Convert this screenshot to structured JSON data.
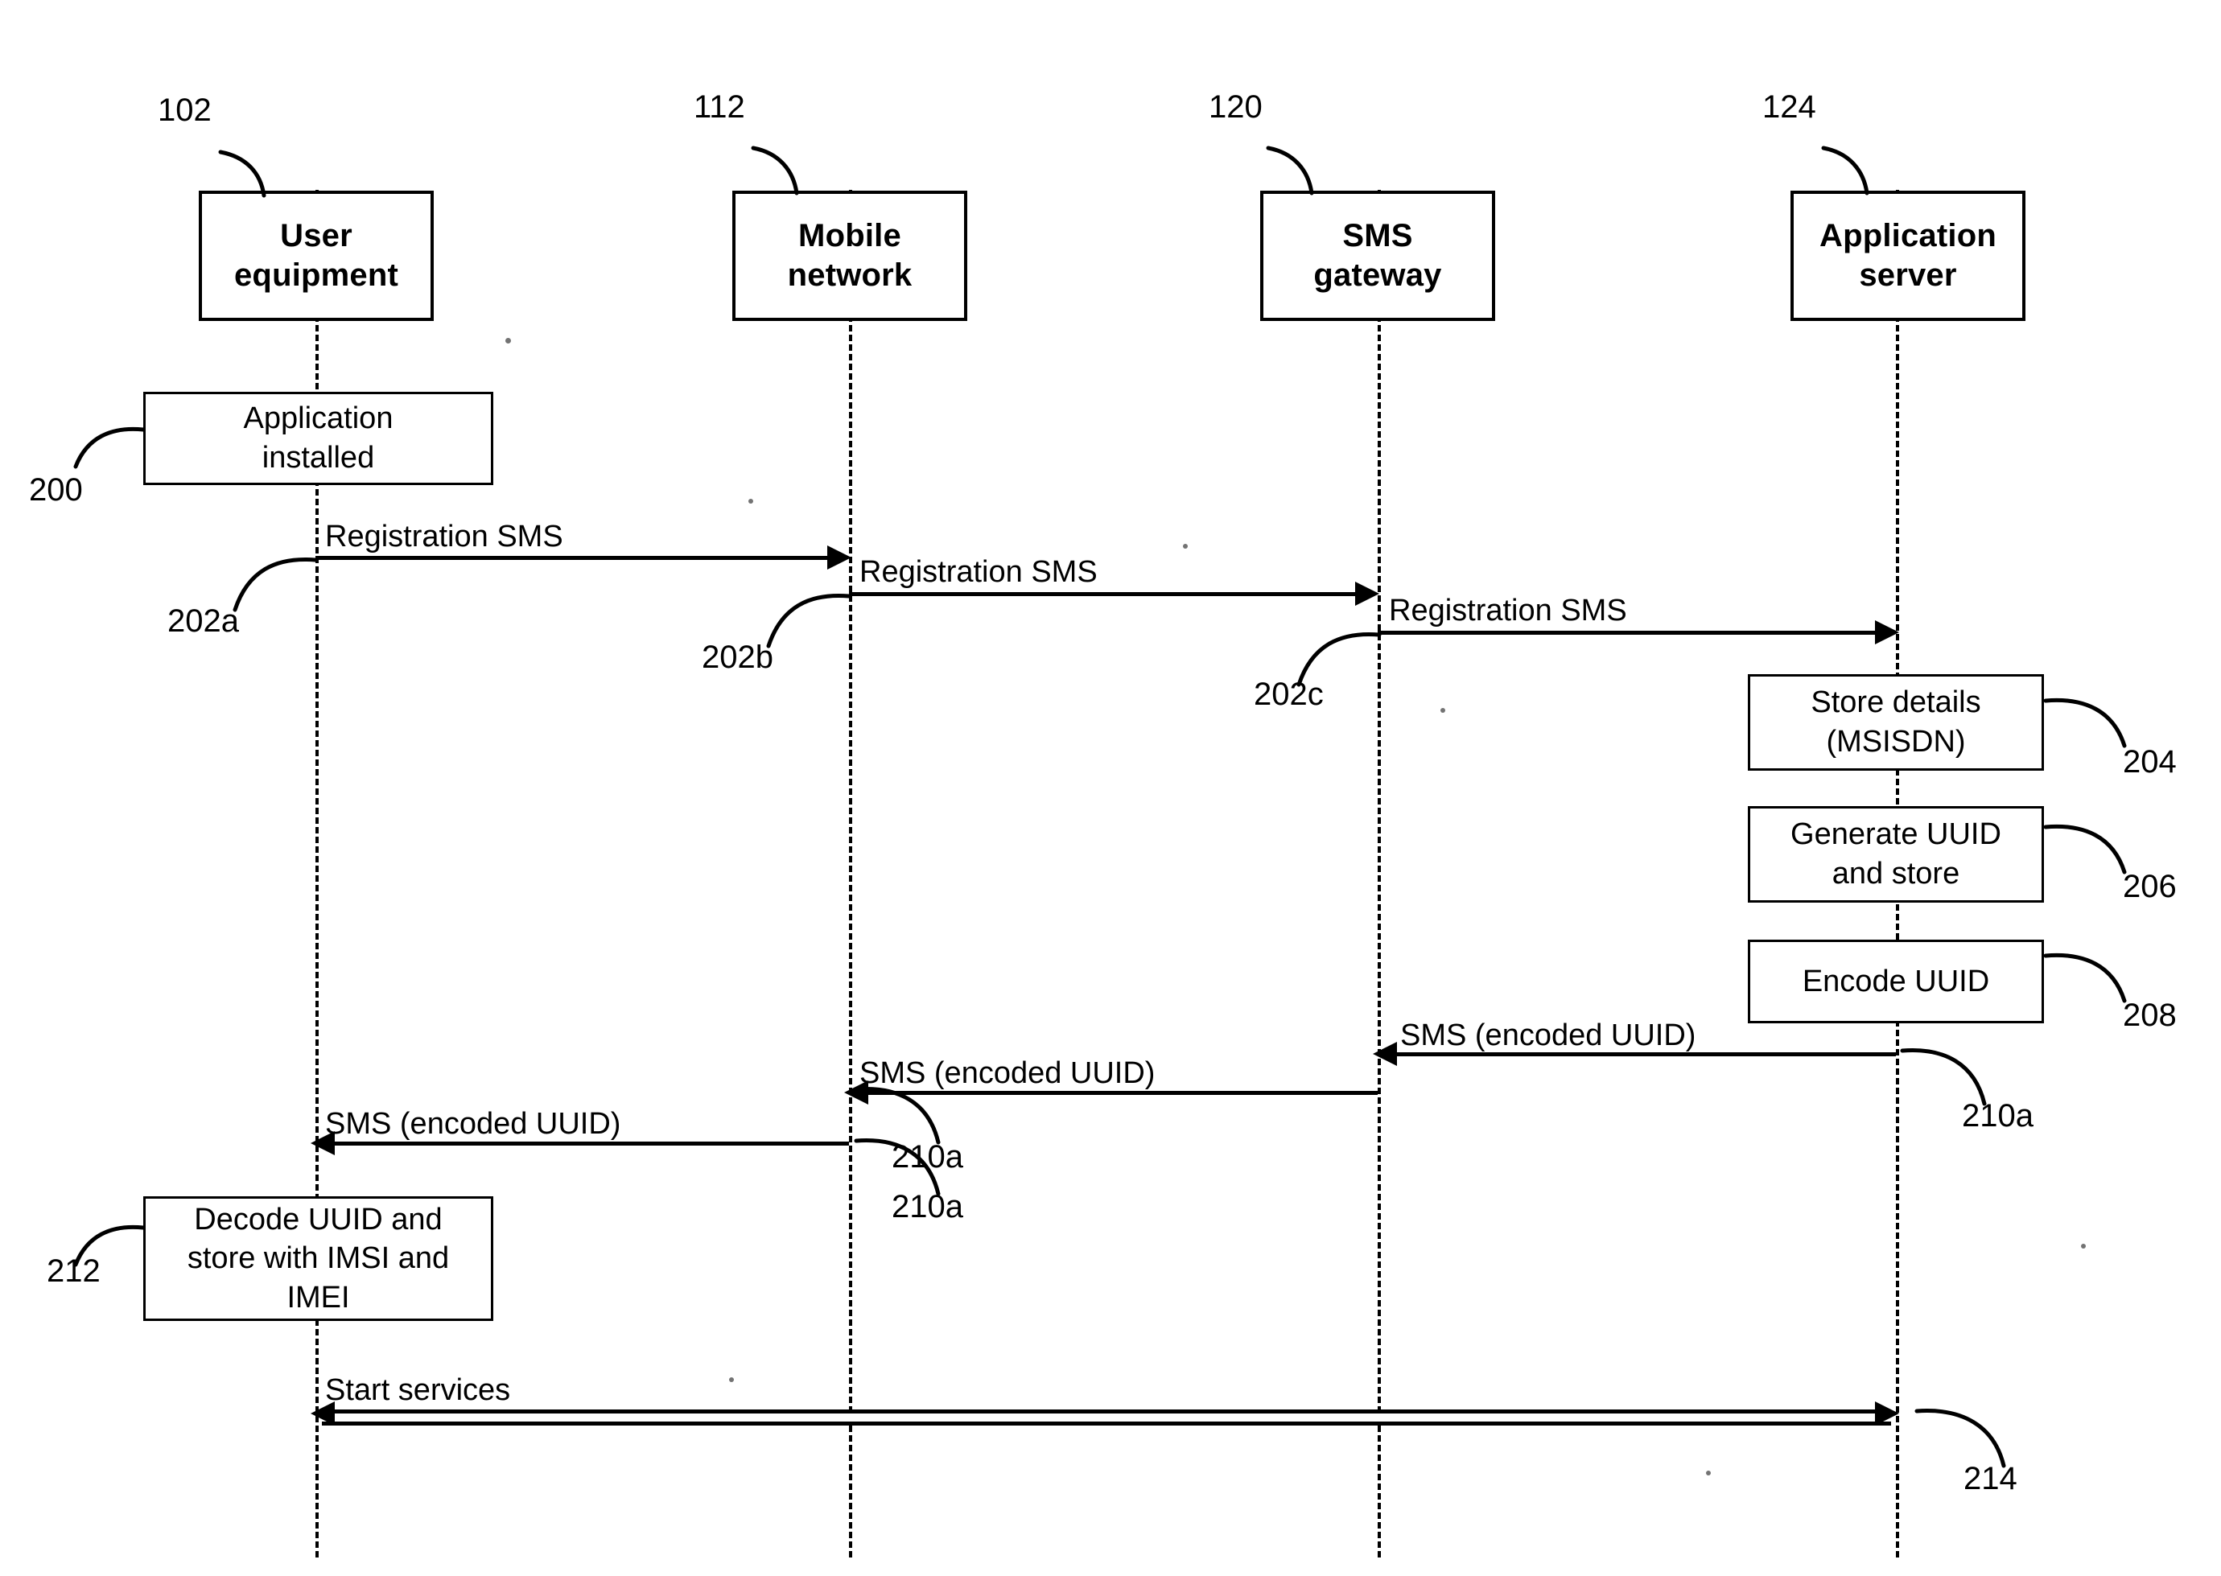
{
  "figure": {
    "type": "sequence-diagram",
    "background": "#ffffff",
    "stroke": "#000000"
  },
  "actors": [
    {
      "ref": "102",
      "line1": "User",
      "line2": "equipment"
    },
    {
      "ref": "112",
      "line1": "Mobile",
      "line2": "network"
    },
    {
      "ref": "120",
      "line1": "SMS",
      "line2": "gateway"
    },
    {
      "ref": "124",
      "line1": "Application",
      "line2": "server"
    }
  ],
  "process_boxes": [
    {
      "ref": "200",
      "lines": [
        "Application",
        "installed"
      ]
    },
    {
      "ref": "204",
      "lines": [
        "Store details",
        "(MSISDN)"
      ]
    },
    {
      "ref": "206",
      "lines": [
        "Generate UUID",
        "and store"
      ]
    },
    {
      "ref": "208",
      "lines": [
        "Encode UUID"
      ]
    },
    {
      "ref": "212",
      "lines": [
        "Decode UUID and",
        "store with IMSI and",
        "IMEI"
      ]
    }
  ],
  "messages": [
    {
      "ref": "202a",
      "label": "Registration SMS",
      "from": "User equipment",
      "to": "Mobile network",
      "direction": "right"
    },
    {
      "ref": "202b",
      "label": "Registration SMS",
      "from": "Mobile network",
      "to": "SMS gateway",
      "direction": "right"
    },
    {
      "ref": "202c",
      "label": "Registration SMS",
      "from": "SMS gateway",
      "to": "Application server",
      "direction": "right"
    },
    {
      "ref": "210a",
      "label": "SMS (encoded UUID)",
      "from": "Application server",
      "to": "SMS gateway",
      "direction": "left"
    },
    {
      "ref": "210a",
      "label": "SMS (encoded UUID)",
      "from": "SMS gateway",
      "to": "Mobile network",
      "direction": "left"
    },
    {
      "ref": "210a",
      "label": "SMS (encoded UUID)",
      "from": "Mobile network",
      "to": "User equipment",
      "direction": "left"
    },
    {
      "ref": "214",
      "label": "Start services",
      "from": "Application server",
      "to": "User equipment",
      "direction": "both"
    }
  ]
}
